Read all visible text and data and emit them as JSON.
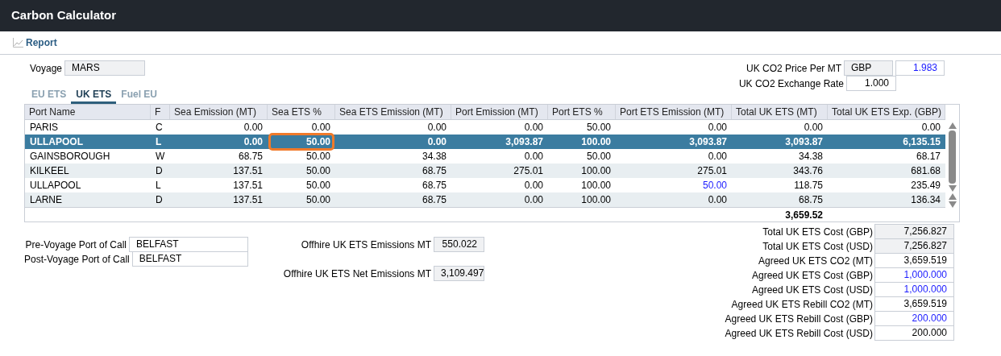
{
  "window": {
    "title": "Carbon Calculator"
  },
  "toolbar": {
    "report_button": "Report"
  },
  "voyage": {
    "label": "Voyage",
    "value": "MARS"
  },
  "price": {
    "label": "UK CO2 Price Per MT",
    "currency": "GBP",
    "value": "1.983",
    "edited": true
  },
  "exchange": {
    "label": "UK CO2 Exchange Rate",
    "value": "1.000"
  },
  "tabs": [
    {
      "label": "EU ETS",
      "selected": false
    },
    {
      "label": "UK ETS",
      "selected": true
    },
    {
      "label": "Fuel EU",
      "selected": false
    }
  ],
  "table": {
    "columns": [
      "Port Name",
      "F",
      "Sea Emission (MT)",
      "Sea ETS %",
      "Sea ETS Emission (MT)",
      "Port Emission (MT)",
      "Port ETS %",
      "Port ETS Emission (MT)",
      "Total UK ETS (MT)",
      "Total UK ETS Exp. (GBP)"
    ],
    "rows": [
      {
        "selected": false,
        "cells": [
          "PARIS",
          "C",
          "0.00",
          "0.00",
          "0.00",
          "0.00",
          "50.00",
          "0.00",
          "0.00",
          "0.00"
        ]
      },
      {
        "selected": true,
        "cells": [
          "ULLAPOOL",
          "L",
          "0.00",
          {
            "text": "50.00",
            "focused": true
          },
          "0.00",
          "3,093.87",
          "100.00",
          "3,093.87",
          "3,093.87",
          "6,135.15"
        ]
      },
      {
        "selected": false,
        "cells": [
          "GAINSBOROUGH",
          "W",
          "68.75",
          "50.00",
          "34.38",
          "0.00",
          "50.00",
          "0.00",
          "34.38",
          "68.17"
        ]
      },
      {
        "selected": false,
        "cells": [
          "KILKEEL",
          "D",
          "137.51",
          "50.00",
          "68.75",
          "275.01",
          "100.00",
          "275.01",
          "343.76",
          "681.68"
        ]
      },
      {
        "selected": false,
        "cells": [
          "ULLAPOOL",
          "L",
          "137.51",
          "50.00",
          "68.75",
          "0.00",
          "100.00",
          {
            "text": "50.00",
            "edited": true
          },
          "118.75",
          "235.49"
        ]
      },
      {
        "selected": false,
        "cells": [
          "LARNE",
          "D",
          "137.51",
          "50.00",
          "68.75",
          "0.00",
          "100.00",
          "0.00",
          "68.75",
          "136.34"
        ]
      }
    ],
    "total": "3,659.52"
  },
  "ports": [
    {
      "label": "Pre-Voyage Port of Call",
      "value": "BELFAST"
    },
    {
      "label": "Post-Voyage Port of Call",
      "value": "BELFAST"
    }
  ],
  "offhire": [
    {
      "label": "Offhire UK ETS Emissions MT",
      "value": "550.022"
    },
    {
      "label": "Offhire UK ETS Net Emissions MT",
      "value": "3,109.497"
    }
  ],
  "summary": [
    {
      "label": "Total UK ETS Cost (GBP)",
      "value": "7,256.827",
      "kind": "readonly",
      "edited": false
    },
    {
      "label": "Total UK ETS Cost (USD)",
      "value": "7,256.827",
      "kind": "readonly",
      "edited": false
    },
    {
      "label": "Agreed UK ETS CO2 (MT)",
      "value": "3,659.519",
      "kind": "editable",
      "edited": false
    },
    {
      "label": "Agreed UK ETS Cost (GBP)",
      "value": "1,000.000",
      "kind": "editable",
      "edited": true
    },
    {
      "label": "Agreed UK ETS Cost (USD)",
      "value": "1,000.000",
      "kind": "editable",
      "edited": true
    },
    {
      "label": "Agreed UK ETS Rebill CO2 (MT)",
      "value": "3,659.519",
      "kind": "editable",
      "edited": false
    },
    {
      "label": "Agreed UK ETS Rebill Cost (GBP)",
      "value": "200.000",
      "kind": "editable",
      "edited": true
    },
    {
      "label": "Agreed UK ETS Rebill Cost (USD)",
      "value": "200.000",
      "kind": "editable",
      "edited": false
    }
  ]
}
